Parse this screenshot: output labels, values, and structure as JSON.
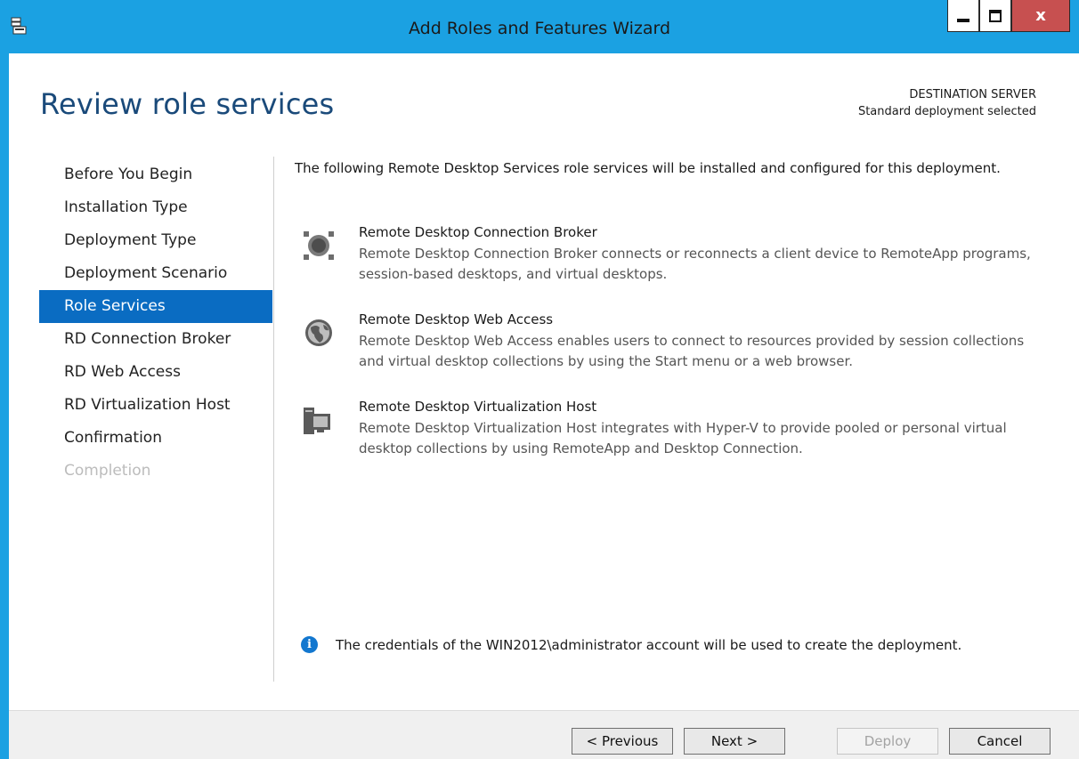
{
  "window": {
    "title": "Add Roles and Features Wizard",
    "close_glyph": "x"
  },
  "page": {
    "title": "Review role services",
    "destination_label": "DESTINATION SERVER",
    "destination_value": "Standard deployment selected"
  },
  "nav": {
    "items": [
      {
        "label": "Before You Begin",
        "state": "normal"
      },
      {
        "label": "Installation Type",
        "state": "normal"
      },
      {
        "label": "Deployment Type",
        "state": "normal"
      },
      {
        "label": "Deployment Scenario",
        "state": "normal"
      },
      {
        "label": "Role Services",
        "state": "active"
      },
      {
        "label": "RD Connection Broker",
        "state": "normal"
      },
      {
        "label": "RD Web Access",
        "state": "normal"
      },
      {
        "label": "RD Virtualization Host",
        "state": "normal"
      },
      {
        "label": "Confirmation",
        "state": "normal"
      },
      {
        "label": "Completion",
        "state": "disabled"
      }
    ]
  },
  "content": {
    "intro": "The following Remote Desktop Services role services will be installed and configured for this deployment.",
    "services": [
      {
        "icon": "connection-broker-icon",
        "title": "Remote Desktop Connection Broker",
        "description": "Remote Desktop Connection Broker connects or reconnects a client device to RemoteApp programs, session-based desktops, and virtual desktops."
      },
      {
        "icon": "web-access-globe-icon",
        "title": "Remote Desktop Web Access",
        "description": "Remote Desktop Web Access enables users to connect to resources provided by session collections and virtual desktop collections by using the Start menu or a web browser."
      },
      {
        "icon": "virtualization-host-icon",
        "title": "Remote Desktop Virtualization Host",
        "description": "Remote Desktop Virtualization Host integrates with Hyper-V to provide pooled or personal virtual desktop collections by using RemoteApp and Desktop Connection."
      }
    ],
    "info": "The credentials of the WIN2012\\administrator account will be used to create the deployment."
  },
  "footer": {
    "previous": "< Previous",
    "next": "Next >",
    "deploy": "Deploy",
    "cancel": "Cancel"
  },
  "colors": {
    "accent": "#1ba1e2",
    "nav_active": "#0a6cc2",
    "close_button": "#c75050",
    "info": "#1277cf"
  }
}
